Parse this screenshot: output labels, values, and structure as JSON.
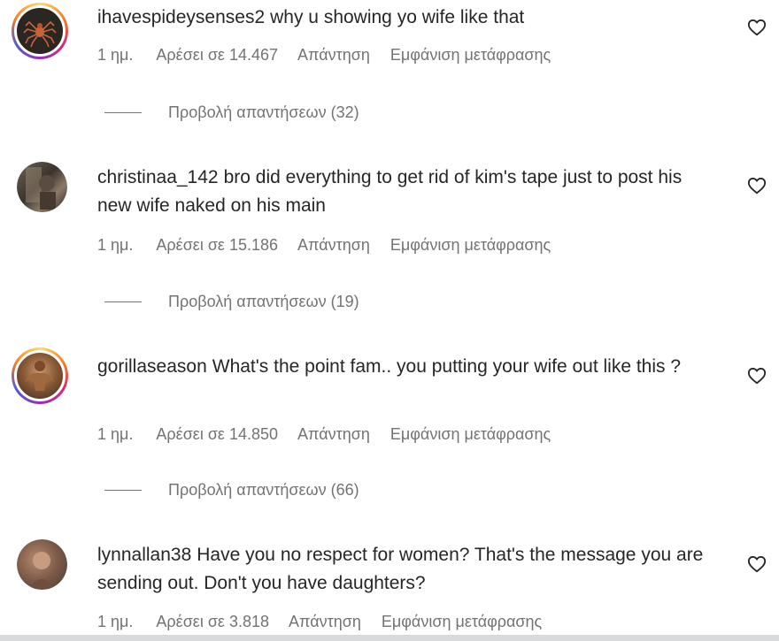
{
  "comments": [
    {
      "username": "ihavespideysenses2",
      "text": "why u showing yo wife like that",
      "time": "1 ημ.",
      "likes": "Αρέσει σε 14.467",
      "reply": "Απάντηση",
      "translate": "Εμφάνιση μετάφρασης",
      "view_replies": "Προβολή απαντήσεων (32)",
      "avatar_icon": "spider-avatar-icon"
    },
    {
      "username": "christinaa_142",
      "text": "bro did everything to get rid of kim's tape just to post his new wife naked on his main",
      "time": "1 ημ.",
      "likes": "Αρέσει σε 15.186",
      "reply": "Απάντηση",
      "translate": "Εμφάνιση μετάφρασης",
      "view_replies": "Προβολή απαντήσεων (19)",
      "avatar_icon": "user-photo-avatar-icon"
    },
    {
      "username": "gorillaseason",
      "text": "What's the point fam.. you putting your wife out like this ?",
      "time": "1 ημ.",
      "likes": "Αρέσει σε 14.850",
      "reply": "Απάντηση",
      "translate": "Εμφάνιση μετάφρασης",
      "view_replies": "Προβολή απαντήσεων (66)",
      "avatar_icon": "bodybuilder-avatar-icon"
    },
    {
      "username": "lynnallan38",
      "text": "Have you no respect for women? That's the message you are sending out. Don't you have daughters?",
      "time": "1 ημ.",
      "likes": "Αρέσει σε 3.818",
      "reply": "Απάντηση",
      "translate": "Εμφάνιση μετάφρασης",
      "avatar_icon": "user-photo-avatar-icon"
    }
  ],
  "colors": {
    "text": "#262626",
    "secondary": "#737373",
    "story_ring": "#d62976"
  }
}
